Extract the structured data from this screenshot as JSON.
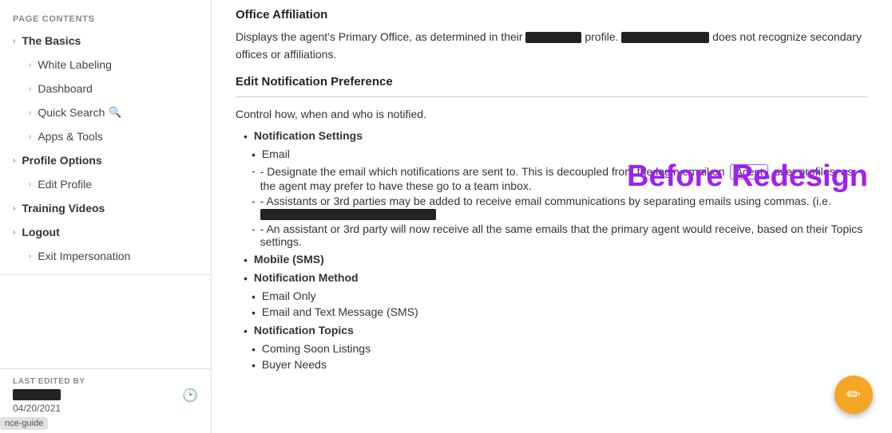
{
  "sidebar": {
    "section_label": "PAGE CONTENTS",
    "items": [
      {
        "id": "the-basics",
        "label": "The Basics",
        "level": "parent",
        "chevron": "›"
      },
      {
        "id": "white-labeling",
        "label": "White Labeling",
        "level": "child",
        "chevron": "›"
      },
      {
        "id": "dashboard",
        "label": "Dashboard",
        "level": "child",
        "chevron": "›"
      },
      {
        "id": "quick-search",
        "label": "Quick Search",
        "level": "child",
        "chevron": "›",
        "icon": "🔍"
      },
      {
        "id": "apps-tools",
        "label": "Apps & Tools",
        "level": "child",
        "chevron": "›"
      },
      {
        "id": "profile-options",
        "label": "Profile Options",
        "level": "parent",
        "chevron": "›"
      },
      {
        "id": "edit-profile",
        "label": "Edit Profile",
        "level": "child",
        "chevron": "›"
      },
      {
        "id": "training-videos",
        "label": "Training Videos",
        "level": "parent",
        "chevron": "›"
      },
      {
        "id": "logout",
        "label": "Logout",
        "level": "parent",
        "chevron": "›"
      },
      {
        "id": "exit-impersonation",
        "label": "Exit Impersonation",
        "level": "child",
        "chevron": "›"
      }
    ],
    "last_edited": {
      "label": "LAST EDITED BY",
      "date": "04/20/2021"
    }
  },
  "main": {
    "office_affiliation_title": "Office Affiliation",
    "office_affiliation_text1": "Displays the agent's Primary Office, as determined in their",
    "office_affiliation_text2": "profile.",
    "office_affiliation_text3": "does not recognize secondary offices or affiliations.",
    "edit_pref_title": "Edit Notification Preference",
    "control_text": "Control how, when and who is notified.",
    "notification_settings_label": "Notification Settings",
    "email_label": "Email",
    "email_desc1_before": "- Designate the email which notifications are sent to. This is decoupled from the login email on",
    "agent_badge": "Agent",
    "email_desc1_after": "user profiles, as the agent may prefer to have these go to a team inbox.",
    "email_desc2": "- Assistants or 3rd parties may be added to receive email communications by separating emails using commas. (i.e.",
    "email_desc3": "- An assistant or 3rd party will now receive all the same emails that the primary agent would receive, based on their Topics settings.",
    "mobile_sms_label": "Mobile (SMS)",
    "notification_method_label": "Notification Method",
    "method_options": [
      {
        "label": "Email Only"
      },
      {
        "label": "Email and Text Message (SMS)"
      }
    ],
    "notification_topics_label": "Notification Topics",
    "topics": [
      {
        "label": "Coming Soon Listings"
      },
      {
        "label": "Buyer Needs"
      }
    ],
    "before_redesign_text": "Before Redesign",
    "fab_icon": "✎",
    "guide_badge": "nce-guide"
  }
}
